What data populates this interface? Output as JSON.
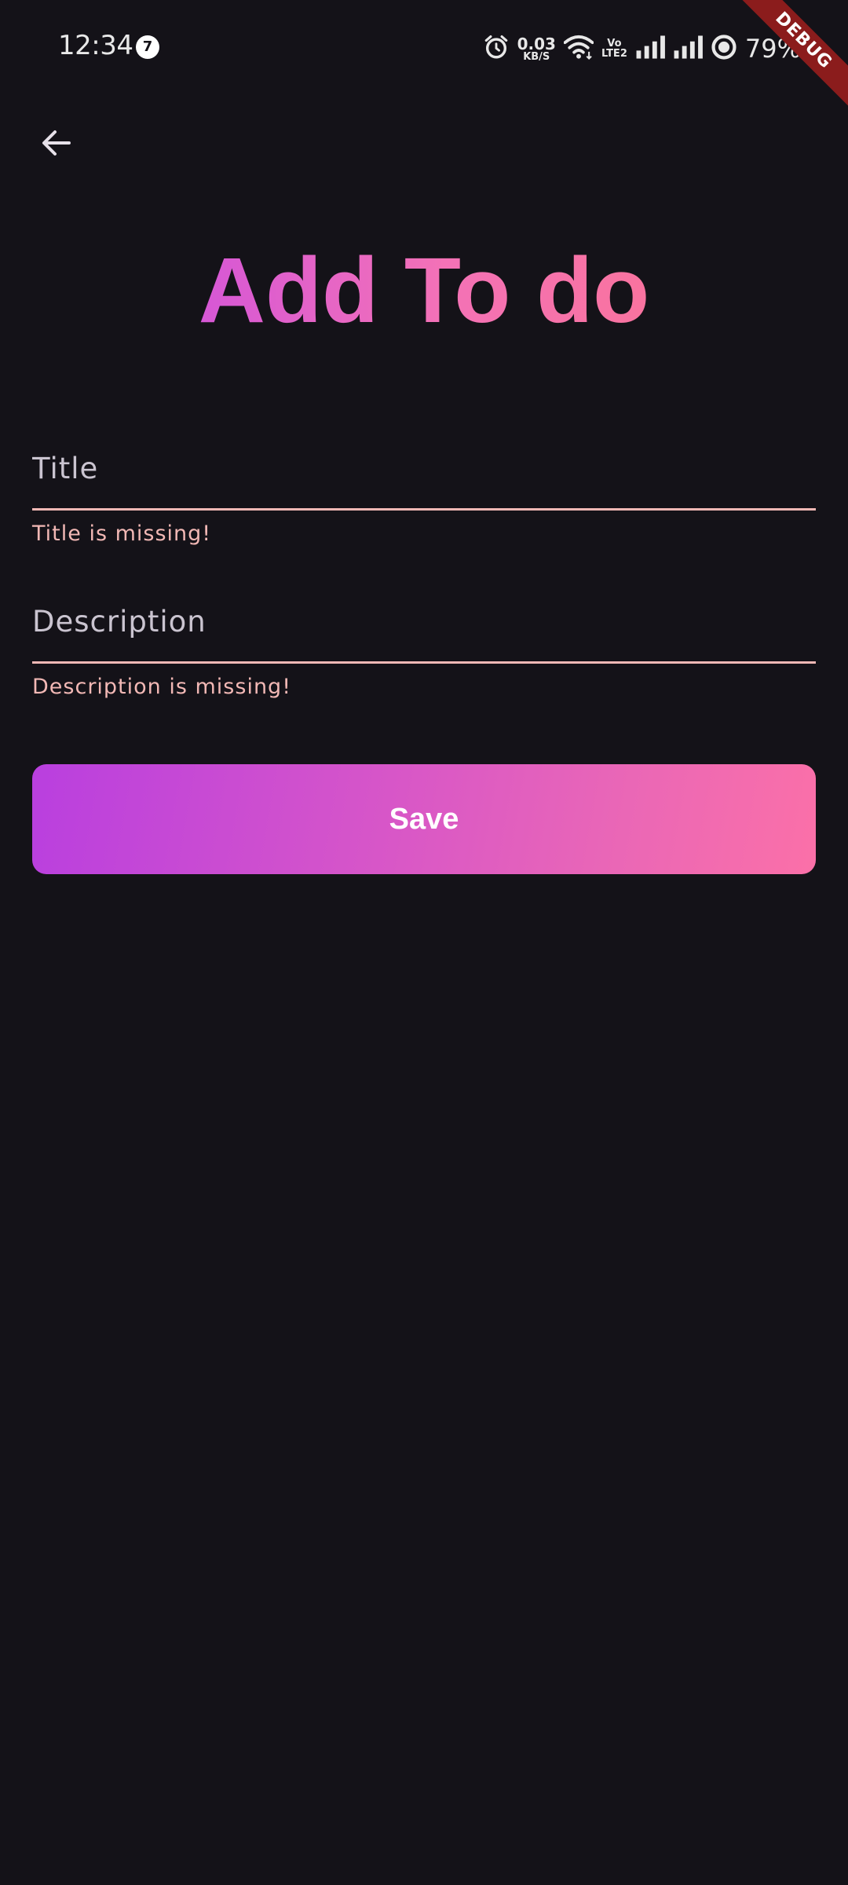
{
  "status_bar": {
    "time": "12:34",
    "notification_count": "7",
    "net_speed_value": "0.03",
    "net_speed_unit": "KB/S",
    "volte_top": "Vo",
    "volte_bottom": "LTE2",
    "battery_percent": "79%",
    "icons": [
      "alarm-icon",
      "wifi-icon",
      "volte-icon",
      "signal-icon",
      "signal-icon",
      "battery-icon"
    ]
  },
  "debug_banner": "DEBUG",
  "header": {
    "back_icon": "arrow-left-icon"
  },
  "page": {
    "title": "Add To do"
  },
  "form": {
    "title_field": {
      "placeholder": "Title",
      "value": "",
      "error": "Title is missing!"
    },
    "description_field": {
      "placeholder": "Description",
      "value": "",
      "error": "Description is missing!"
    },
    "save_label": "Save"
  },
  "colors": {
    "background": "#141218",
    "error": "#f2b8b5",
    "gradient_start": "#b93fdf",
    "gradient_end": "#fb70a8",
    "debug_ribbon": "#8b1c1c"
  }
}
